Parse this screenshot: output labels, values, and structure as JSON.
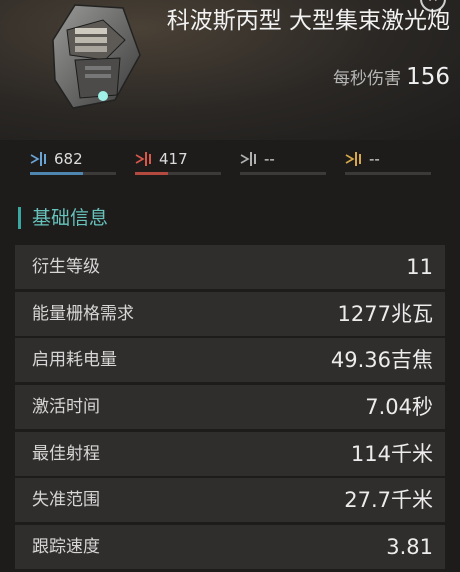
{
  "item": {
    "title": "科波斯丙型 大型集束激光炮",
    "dps_label": "每秒伤害",
    "dps_value": "156"
  },
  "damage": [
    {
      "icon": "em-damage-icon",
      "value": "682",
      "fraction": 0.62,
      "color": "#4f86b0"
    },
    {
      "icon": "thermal-damage-icon",
      "value": "417",
      "fraction": 0.38,
      "color": "#b44a3f"
    },
    {
      "icon": "kinetic-damage-icon",
      "value": "--",
      "fraction": 0,
      "color": "#8a8a8a"
    },
    {
      "icon": "explosive-damage-icon",
      "value": "--",
      "fraction": 0,
      "color": "#b58e3a"
    }
  ],
  "section": {
    "title": "基础信息",
    "accent": "#3aa7a0"
  },
  "stats": [
    {
      "label": "衍生等级",
      "value": "11"
    },
    {
      "label": "能量栅格需求",
      "value": "1277兆瓦"
    },
    {
      "label": "启用耗电量",
      "value": "49.36吉焦"
    },
    {
      "label": "激活时间",
      "value": "7.04秒"
    },
    {
      "label": "最佳射程",
      "value": "114千米"
    },
    {
      "label": "失准范围",
      "value": "27.7千米"
    },
    {
      "label": "跟踪速度",
      "value": "3.81"
    }
  ]
}
